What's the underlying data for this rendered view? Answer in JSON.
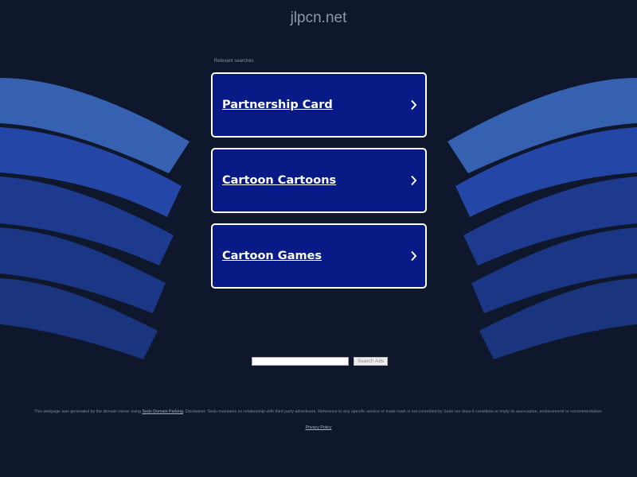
{
  "header": {
    "domain": "jlpcn.net"
  },
  "related_searches": {
    "label": "Relevant searches",
    "items": [
      {
        "label": "Partnership Card"
      },
      {
        "label": "Cartoon Cartoons"
      },
      {
        "label": "Cartoon Games"
      }
    ]
  },
  "ad_search": {
    "input_value": "",
    "button_label": "Search Ads"
  },
  "footer": {
    "disclaimer_prefix": "This webpage was generated by the domain owner using ",
    "sedo_link_label": "Sedo Domain Parking",
    "disclaimer_suffix": ". Disclaimer: Sedo maintains no relationship with third party advertisers. Reference to any specific service or trade mark is not controlled by Sedo nor does it constitute or imply its association, endorsement or recommendation.",
    "privacy_label": "Privacy Policy"
  },
  "colors": {
    "background": "#0e172c",
    "link_box": "#071a85",
    "wing_light": "#3561b0",
    "wing_mid": "#2446a7",
    "wing_dark": "#1d3a8e",
    "wing_darker": "#1a3580"
  },
  "icons": {
    "link_arrow": "chevron-right-icon"
  }
}
